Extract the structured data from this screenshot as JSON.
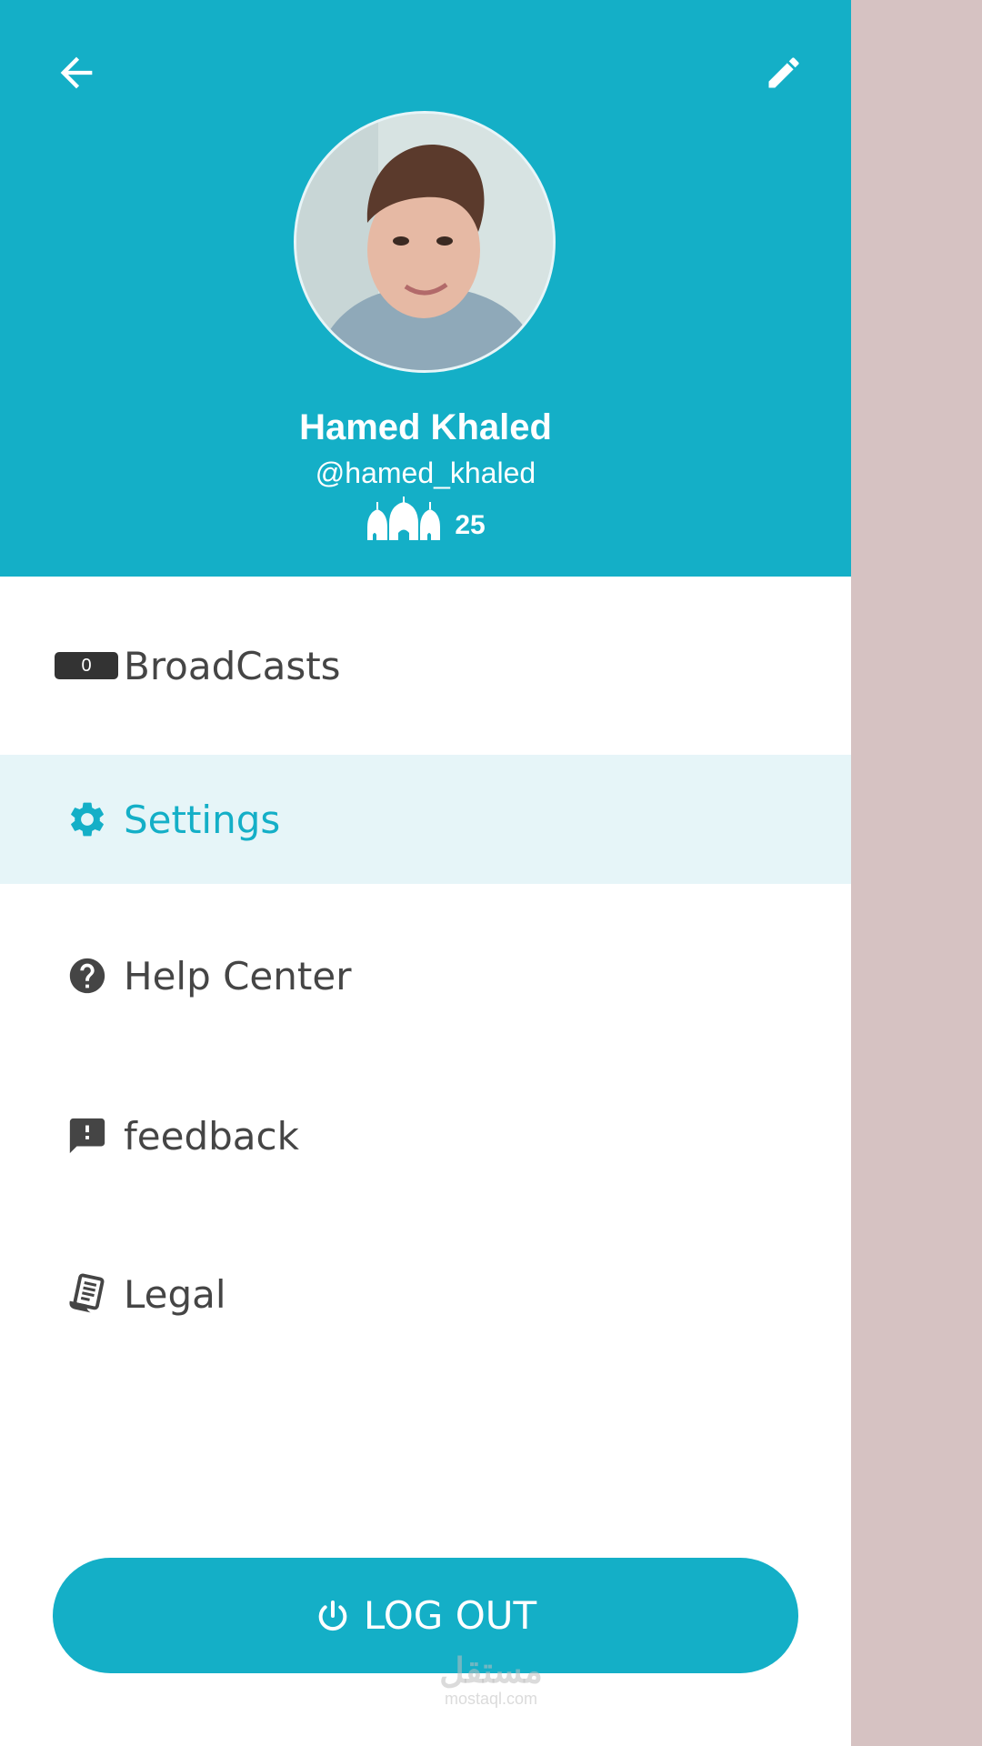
{
  "header": {
    "back_icon": "arrow-left-icon",
    "edit_icon": "pencil-icon",
    "background_color": "#14afc7"
  },
  "profile": {
    "name": "Hamed Khaled",
    "handle": "@hamed_khaled",
    "points_icon": "domes-icon",
    "points": "25"
  },
  "menu": {
    "items": [
      {
        "id": "broadcasts",
        "label": "BroadCasts",
        "badge": "0",
        "icon": "badge-counter"
      },
      {
        "id": "settings",
        "label": "Settings",
        "icon": "gear-icon",
        "active": true
      },
      {
        "id": "help",
        "label": "Help Center",
        "icon": "question-circle-icon"
      },
      {
        "id": "feedback",
        "label": "feedback",
        "icon": "feedback-icon"
      },
      {
        "id": "legal",
        "label": "Legal",
        "icon": "document-icon"
      }
    ]
  },
  "logout": {
    "label": "LOG OUT",
    "icon": "power-icon"
  },
  "watermark": {
    "arabic": "مستقل",
    "latin": "mostaql.com"
  },
  "colors": {
    "accent": "#14afc7",
    "active_row": "#e6f5f8",
    "scrim": "#d6c2c2",
    "text": "#454545"
  }
}
